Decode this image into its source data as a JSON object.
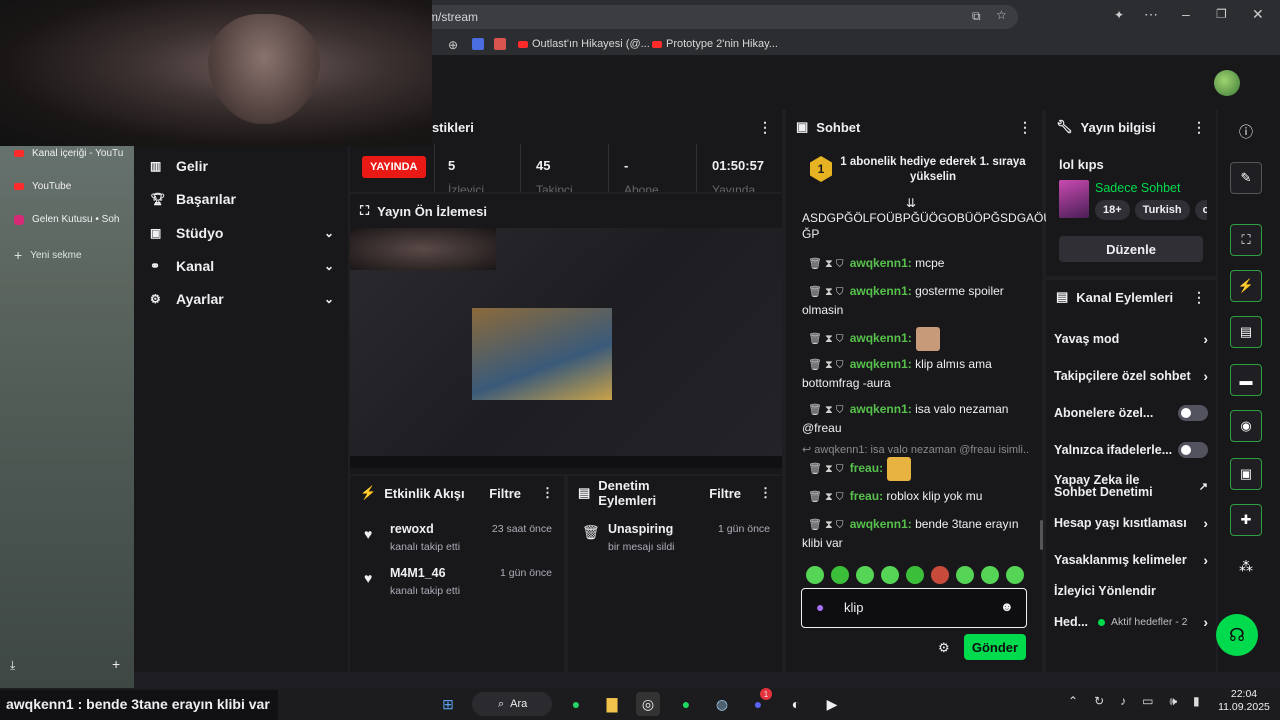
{
  "browser": {
    "url": "m/stream",
    "bookmarks": [
      "Outlast'ın Hikayesi (@...",
      "Prototype 2'nin Hikay..."
    ],
    "side_tabs": [
      "Kanal içeriği - YouTu",
      "YouTube",
      "Gelen Kutusu • Soh"
    ],
    "new_tab": "Yeni sekme"
  },
  "nav": {
    "items": [
      {
        "label": "Gelir",
        "icon": "revenue-icon",
        "chevron": false
      },
      {
        "label": "Başarılar",
        "icon": "trophy-icon",
        "chevron": false
      },
      {
        "label": "Stüdyo",
        "icon": "studio-icon",
        "chevron": true
      },
      {
        "label": "Kanal",
        "icon": "channel-icon",
        "chevron": true
      },
      {
        "label": "Ayarlar",
        "icon": "gear-icon",
        "chevron": true
      }
    ]
  },
  "stats": {
    "title": "tistikleri",
    "live_badge": "YAYINDA",
    "values": [
      {
        "value": "5",
        "label": "İzleyici"
      },
      {
        "value": "45",
        "label": "Takipçi"
      },
      {
        "value": "-",
        "label": "Abone"
      },
      {
        "value": "01:50:57",
        "label": "Yayında"
      }
    ]
  },
  "preview": {
    "title": "Yayın Ön İzlemesi"
  },
  "activity": {
    "title": "Etkinlik Akışı",
    "filter": "Filtre",
    "items": [
      {
        "user": "rewoxd",
        "action": "kanalı takip etti",
        "time": "23 saat önce"
      },
      {
        "user": "M4M1_46",
        "action": "kanalı takip etti",
        "time": "1 gün önce"
      }
    ]
  },
  "moderation": {
    "title": "Denetim Eylemleri",
    "filter": "Filtre",
    "items": [
      {
        "user": "Unaspiring",
        "action": "bir mesajı sildi",
        "time": "1 gün önce"
      }
    ]
  },
  "chat": {
    "title": "Sohbet",
    "hype_text": "1 abonelik hediye ederek 1. sıraya yükselin",
    "hype_rank": "1",
    "header_text": "ASDGPĞÖLFOÜBPĞÜÖGOBÜÖPĞSDGAÖÜ ĞP",
    "messages": [
      {
        "user": "awqkenn1:",
        "text": " mcpe"
      },
      {
        "user": "awqkenn1:",
        "text": " gosterme spoiler olmasin"
      },
      {
        "user": "awqkenn1:",
        "text": ""
      },
      {
        "user": "awqkenn1:",
        "text": " klip almıs ama bottomfrag -aura"
      },
      {
        "user": "awqkenn1:",
        "text": " isa valo nezaman @freau"
      },
      {
        "user": "freau:",
        "text": ""
      },
      {
        "user": "freau:",
        "text": " roblox klip yok mu"
      },
      {
        "user": "awqkenn1:",
        "text": " bende 3tane erayın klibi var"
      }
    ],
    "reply_preview": "awqkenn1: isa valo nezaman @freau isimli...",
    "input_value": "klip",
    "send_label": "Gönder"
  },
  "stream_info": {
    "title": "Yayın bilgisi",
    "stream_title": "lol kıps",
    "category": "Sadece Sohbet",
    "tags": [
      "18+",
      "Turkish",
      "ch"
    ],
    "edit_label": "Düzenle"
  },
  "channel_actions": {
    "title": "Kanal Eylemleri",
    "rows": [
      {
        "label": "Yavaş mod",
        "type": "chevron"
      },
      {
        "label": "Takipçilere özel sohbet",
        "type": "chevron"
      },
      {
        "label": "Abonelere özel...",
        "type": "toggle"
      },
      {
        "label": "Yalnızca ifadelerle...",
        "type": "toggle"
      },
      {
        "label": "Yapay Zeka ile Sohbet Denetimi",
        "type": "external"
      },
      {
        "label": "Hesap yaşı kısıtlaması",
        "type": "chevron"
      },
      {
        "label": "Yasaklanmış kelimeler",
        "type": "chevron"
      },
      {
        "label": "İzleyici Yönlendir",
        "type": "none"
      }
    ],
    "goals_label": "Hed...",
    "goals_status": "Aktif hedefler - 2"
  },
  "overlay": {
    "caption_user": "awqkenn1",
    "caption_text": " : bende 3tane erayın klibi var"
  },
  "taskbar": {
    "search": "Ara",
    "time": "22:04",
    "date": "11.09.2025",
    "discord_badge": "1"
  },
  "colors": {
    "accent": "#00db4d",
    "live": "#e91916",
    "username": "#57c14c",
    "panel": "#18181b"
  }
}
